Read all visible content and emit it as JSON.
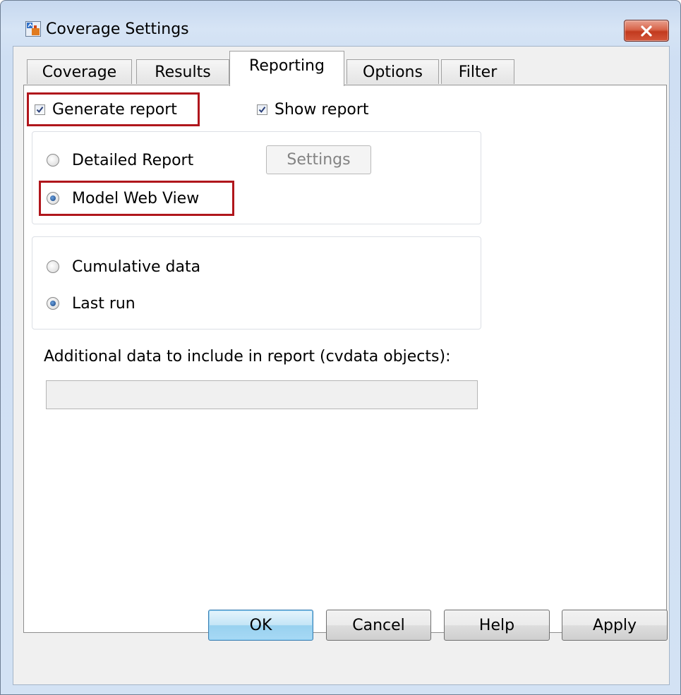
{
  "window": {
    "title": "Coverage Settings"
  },
  "tabs": [
    {
      "label": "Coverage",
      "active": false
    },
    {
      "label": "Results",
      "active": false
    },
    {
      "label": "Reporting",
      "active": true
    },
    {
      "label": "Options",
      "active": false
    },
    {
      "label": "Filter",
      "active": false
    }
  ],
  "reporting": {
    "generate_report": {
      "label": "Generate report",
      "checked": true
    },
    "show_report": {
      "label": "Show report",
      "checked": true
    },
    "report_type": {
      "detailed": {
        "label": "Detailed Report",
        "selected": false
      },
      "web_view": {
        "label": "Model Web View",
        "selected": true
      },
      "settings_button": "Settings"
    },
    "data_scope": {
      "cumulative": {
        "label": "Cumulative data",
        "selected": false
      },
      "last_run": {
        "label": "Last run",
        "selected": true
      }
    },
    "additional_data": {
      "label": "Additional data to include in report (cvdata objects):",
      "value": ""
    }
  },
  "buttons": {
    "ok": "OK",
    "cancel": "Cancel",
    "help": "Help",
    "apply": "Apply"
  },
  "colors": {
    "highlight": "#b0161c",
    "radio_dot": "#14407d",
    "default_button": "#98d1ef"
  }
}
